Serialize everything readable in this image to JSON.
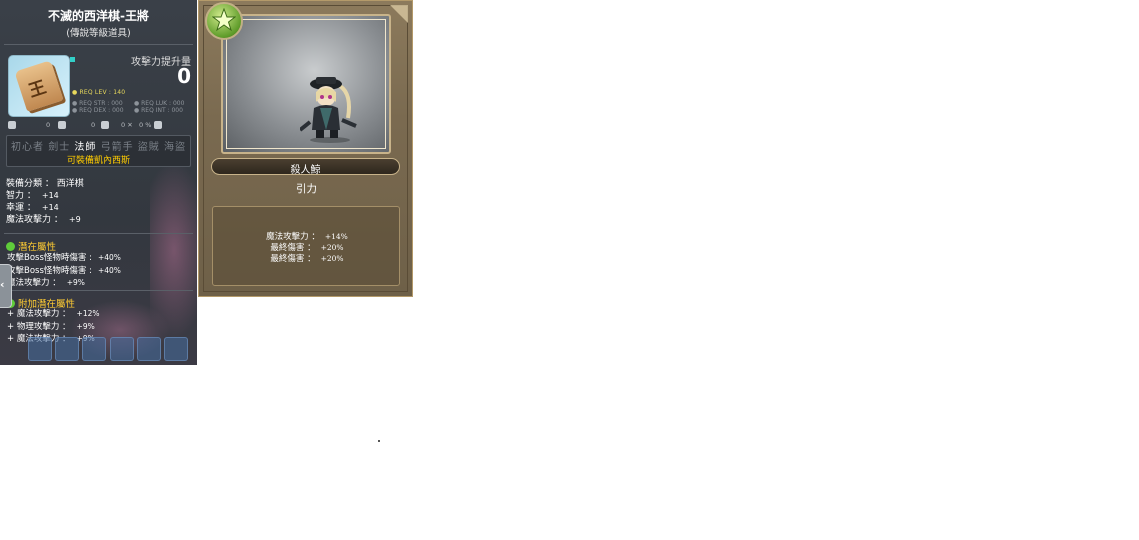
{
  "tooltip": {
    "title": "不滅的西洋棋-王將",
    "subtitle": "(傳說等級道具)",
    "item_icon_glyph": "王",
    "attack_increase_label": "攻擊力提升量",
    "attack_increase_value": "0",
    "req_lev": "● REQ LEV : 140",
    "req_str": "● REQ STR : 000",
    "req_luk": "● REQ LUK : 000",
    "req_dex": "● REQ DEX : 000",
    "req_int": "● REQ INT : 000",
    "icon_row": [
      "0",
      "0",
      "0 ✕",
      "0 %"
    ],
    "jobs": [
      "初心者",
      "劍士",
      "法師",
      "弓箭手",
      "盜賊",
      "海盜"
    ],
    "active_job": "法師",
    "equip_note": "可裝備凱內西斯",
    "base_stats": [
      {
        "label": "裝備分類 ： 西洋棋",
        "value": ""
      },
      {
        "label": "智力 ：",
        "value": "+14"
      },
      {
        "label": "幸運 ：",
        "value": "+14"
      },
      {
        "label": "魔法攻擊力 ：",
        "value": "+9"
      }
    ],
    "potential_header": "潛在屬性",
    "potential_lines": [
      {
        "label": "攻擊Boss怪物時傷害 :",
        "value": "+40%"
      },
      {
        "label": "攻擊Boss怪物時傷害 :",
        "value": "+40%"
      },
      {
        "label": "魔法攻擊力 ：",
        "value": "+9%"
      }
    ],
    "bonus_header": "附加潛在屬性",
    "bonus_lines": [
      {
        "label": "+ 魔法攻擊力 ：",
        "value": "+12%"
      },
      {
        "label": "+ 物理攻擊力 ：",
        "value": "+9%"
      },
      {
        "label": "+ 魔法攻擊力 ：",
        "value": "+9%"
      }
    ],
    "collapse_arrow": "‹"
  },
  "card": {
    "name": "殺人鯨",
    "skill": "引力",
    "stats": [
      {
        "label": "魔法攻擊力 ：",
        "value": "+14%"
      },
      {
        "label": "最終傷害 ：",
        "value": "+20%"
      },
      {
        "label": "最終傷害 ：",
        "value": "+20%"
      }
    ],
    "rank_color": "#5f9c2a"
  }
}
